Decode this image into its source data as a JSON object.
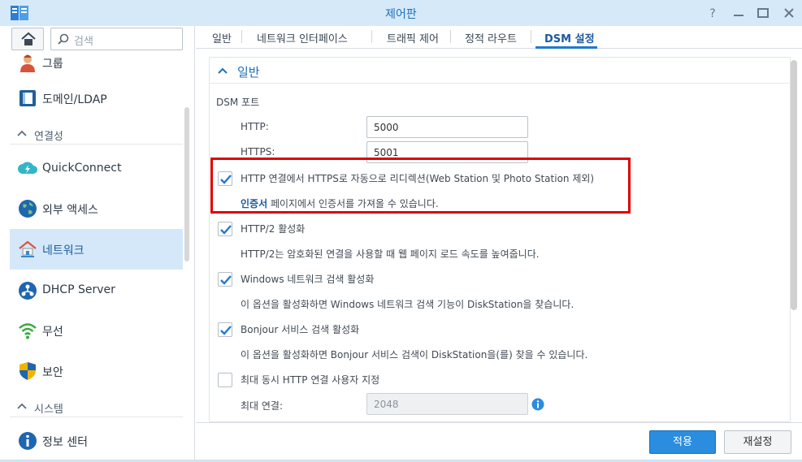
{
  "window": {
    "title": "제어판"
  },
  "sidebar": {
    "search_placeholder": "검색",
    "items": [
      {
        "label": "그룹",
        "icon": "user-group-icon"
      },
      {
        "label": "도메인/LDAP",
        "icon": "domain-ldap-icon"
      },
      {
        "section": "연결성"
      },
      {
        "label": "QuickConnect",
        "icon": "quickconnect-icon"
      },
      {
        "label": "외부 액세스",
        "icon": "globe-icon"
      },
      {
        "label": "네트워크",
        "icon": "network-house-icon",
        "active": true
      },
      {
        "label": "DHCP Server",
        "icon": "dhcp-icon"
      },
      {
        "label": "무선",
        "icon": "wifi-icon"
      },
      {
        "label": "보안",
        "icon": "shield-icon"
      },
      {
        "section": "시스템"
      },
      {
        "label": "정보 센터",
        "icon": "info-icon"
      }
    ]
  },
  "tabs": [
    "일반",
    "네트워크 인터페이스",
    "트래픽 제어",
    "정적 라우트",
    "DSM 설정"
  ],
  "active_tab": "DSM 설정",
  "panel": {
    "title": "일반",
    "dsm_port_label": "DSM 포트",
    "http_label": "HTTP:",
    "http_value": "5000",
    "https_label": "HTTPS:",
    "https_value": "5001",
    "redirect_label": "HTTP 연결에서 HTTPS로 자동으로 리디렉션(Web Station 및 Photo Station 제외)",
    "redirect_checked": true,
    "cert_link": "인증서",
    "cert_text": " 페이지에서 인증서를 가져올 수 있습니다.",
    "http2_label": "HTTP/2 활성화",
    "http2_checked": true,
    "http2_desc": "HTTP/2는 암호화된 연결을 사용할 때 웹 페이지 로드 속도를 높여줍니다.",
    "windows_label": "Windows 네트워크 검색 활성화",
    "windows_checked": true,
    "windows_desc": "이 옵션을 활성화하면 Windows 네트워크 검색 기능이 DiskStation을 찾습니다.",
    "bonjour_label": "Bonjour 서비스 검색 활성화",
    "bonjour_checked": true,
    "bonjour_desc": "이 옵션을 활성화하면 Bonjour 서비스 검색이 DiskStation을(를) 찾을 수 있습니다.",
    "maxconn_label": "최대 동시 HTTP 연결 사용자 지정",
    "maxconn_checked": false,
    "maxconn_field_label": "최대 연결:",
    "maxconn_value": "2048"
  },
  "footer": {
    "apply": "적용",
    "reset": "재설정"
  },
  "colors": {
    "accent": "#2a8de0",
    "highlight": "#e00000",
    "active_nav": "#d4e8fa"
  }
}
